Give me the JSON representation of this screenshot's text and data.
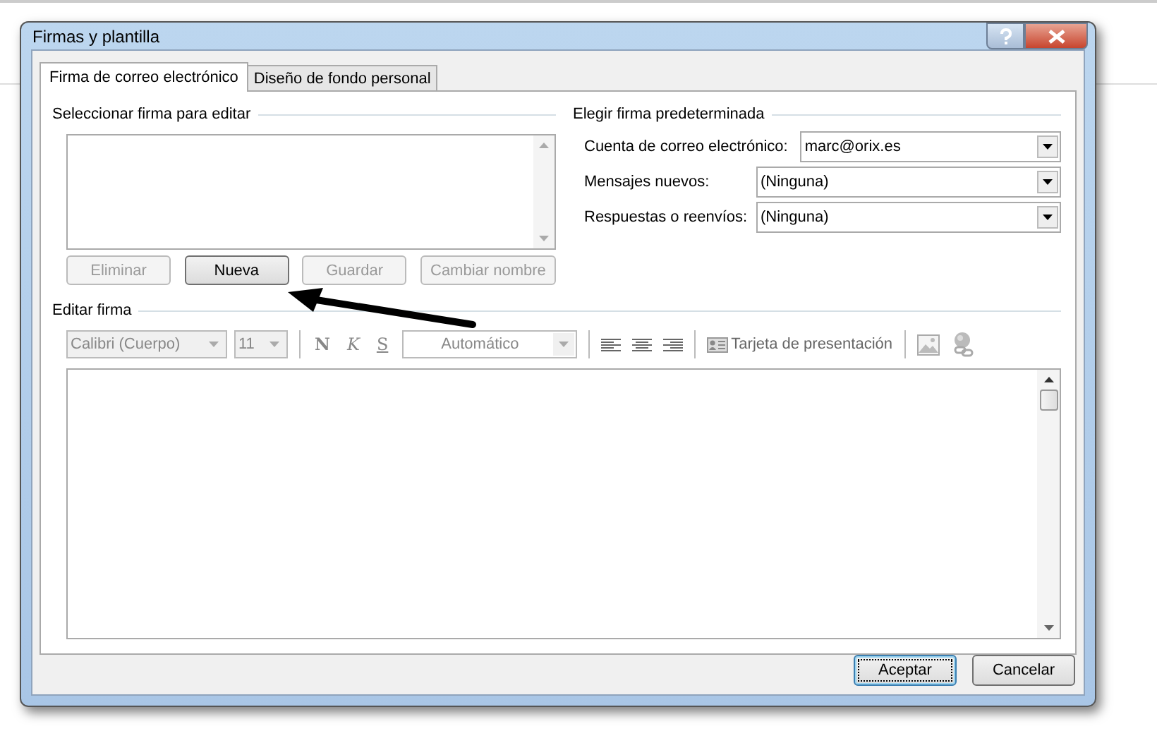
{
  "window": {
    "title": "Firmas y plantilla"
  },
  "tabs": [
    {
      "label": "Firma de correo electrónico",
      "selected": true
    },
    {
      "label": "Diseño de fondo personal",
      "selected": false
    }
  ],
  "select_signature": {
    "heading": "Seleccionar firma para editar",
    "buttons": [
      {
        "label": "Eliminar",
        "disabled": true
      },
      {
        "label": "Nueva",
        "disabled": false
      },
      {
        "label": "Guardar",
        "disabled": true
      },
      {
        "label": "Cambiar nombre",
        "disabled": true
      }
    ]
  },
  "default_signature": {
    "heading": "Elegir firma predeterminada",
    "fields": [
      {
        "label": "Cuenta de correo electrónico:",
        "value": "marc@orix.es"
      },
      {
        "label": "Mensajes nuevos:",
        "value": "(Ninguna)"
      },
      {
        "label": "Respuestas o reenvíos:",
        "value": "(Ninguna)"
      }
    ]
  },
  "edit_signature": {
    "heading": "Editar firma",
    "toolbar": {
      "disabled": true,
      "font": "Calibri (Cuerpo)",
      "size": "11",
      "bold": "N",
      "italic": "K",
      "underline": "S",
      "font_color_label": "Automático",
      "business_card": "Tarjeta de presentación"
    }
  },
  "buttons": [
    {
      "label": "Aceptar",
      "selected": true
    },
    {
      "label": "Cancelar",
      "selected": false
    }
  ]
}
